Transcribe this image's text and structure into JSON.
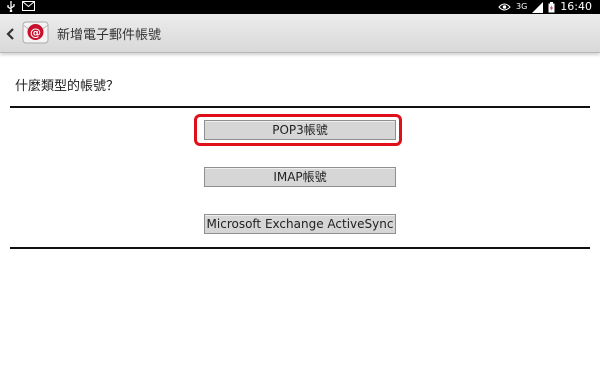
{
  "status_bar": {
    "time": "16:40",
    "network": "3G",
    "icons": [
      "usb-icon",
      "mail-notification-icon",
      "eye-icon",
      "signal-icon",
      "battery-charging-icon"
    ]
  },
  "action_bar": {
    "title": "新增電子郵件帳號",
    "icons": [
      "back-chevron-icon",
      "email-app-icon"
    ]
  },
  "main": {
    "question": "什麼類型的帳號？",
    "buttons": [
      {
        "label": "POP3帳號",
        "highlighted": true
      },
      {
        "label": "IMAP帳號",
        "highlighted": false
      },
      {
        "label": "Microsoft Exchange ActiveSync",
        "highlighted": false
      }
    ]
  },
  "colors": {
    "highlight": "#e0101a",
    "button_bg": "#d6d6d6",
    "action_bar": "#e2e2e2",
    "app_icon_red": "#c8102e"
  }
}
